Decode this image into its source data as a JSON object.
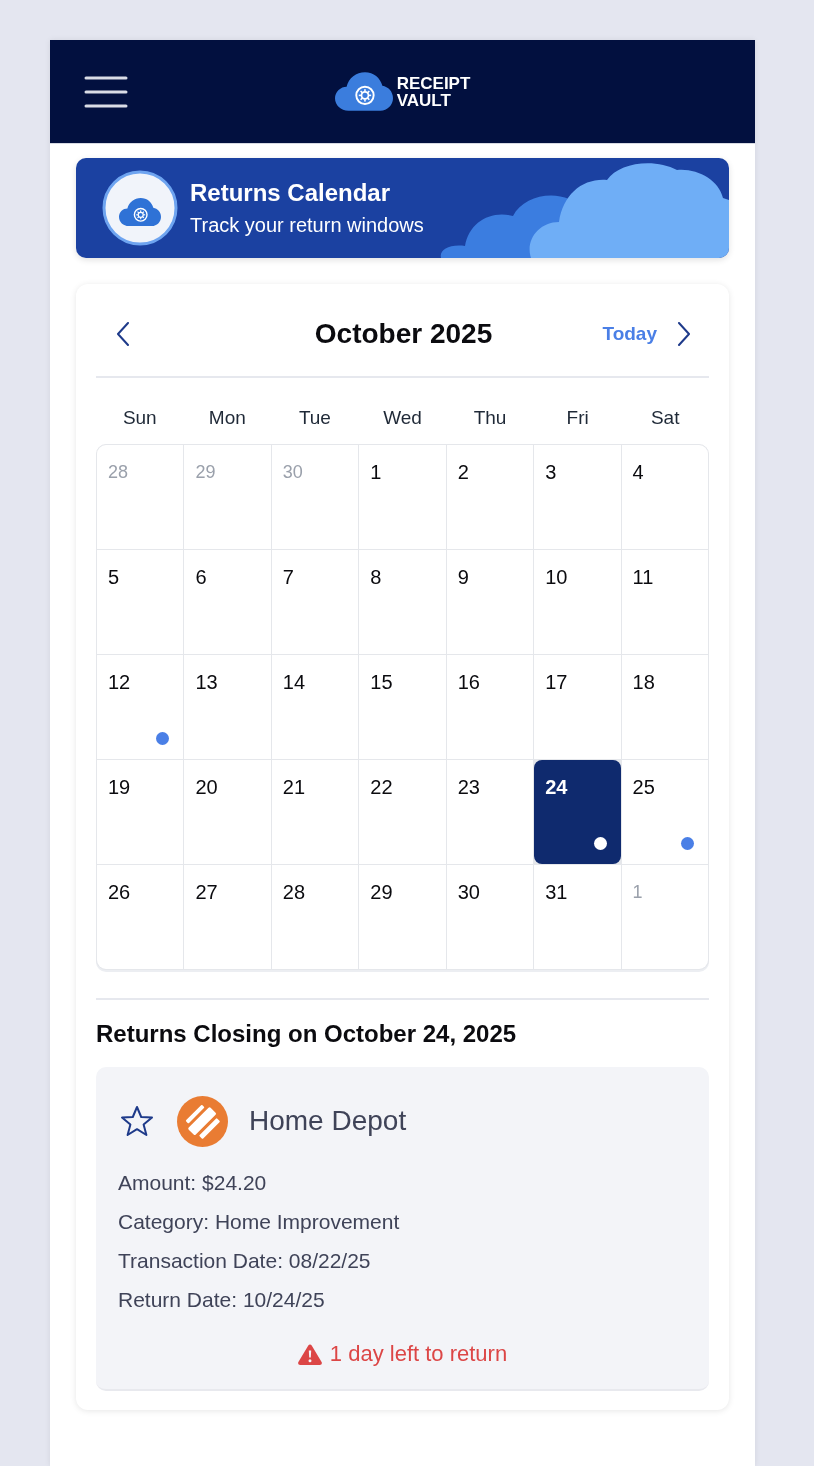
{
  "header": {
    "logo_text": "RECEIPT VAULT"
  },
  "banner": {
    "title": "Returns Calendar",
    "subtitle": "Track your return windows"
  },
  "calendar": {
    "month_title": "October 2025",
    "today_button": "Today",
    "weekdays": [
      "Sun",
      "Mon",
      "Tue",
      "Wed",
      "Thu",
      "Fri",
      "Sat"
    ],
    "days": [
      {
        "day": "28",
        "in_month": false,
        "selected": false,
        "has_return": false
      },
      {
        "day": "29",
        "in_month": false,
        "selected": false,
        "has_return": false
      },
      {
        "day": "30",
        "in_month": false,
        "selected": false,
        "has_return": false
      },
      {
        "day": "1",
        "in_month": true,
        "selected": false,
        "has_return": false
      },
      {
        "day": "2",
        "in_month": true,
        "selected": false,
        "has_return": false
      },
      {
        "day": "3",
        "in_month": true,
        "selected": false,
        "has_return": false
      },
      {
        "day": "4",
        "in_month": true,
        "selected": false,
        "has_return": false
      },
      {
        "day": "5",
        "in_month": true,
        "selected": false,
        "has_return": false
      },
      {
        "day": "6",
        "in_month": true,
        "selected": false,
        "has_return": false
      },
      {
        "day": "7",
        "in_month": true,
        "selected": false,
        "has_return": false
      },
      {
        "day": "8",
        "in_month": true,
        "selected": false,
        "has_return": false
      },
      {
        "day": "9",
        "in_month": true,
        "selected": false,
        "has_return": false
      },
      {
        "day": "10",
        "in_month": true,
        "selected": false,
        "has_return": false
      },
      {
        "day": "11",
        "in_month": true,
        "selected": false,
        "has_return": false
      },
      {
        "day": "12",
        "in_month": true,
        "selected": false,
        "has_return": true
      },
      {
        "day": "13",
        "in_month": true,
        "selected": false,
        "has_return": false
      },
      {
        "day": "14",
        "in_month": true,
        "selected": false,
        "has_return": false
      },
      {
        "day": "15",
        "in_month": true,
        "selected": false,
        "has_return": false
      },
      {
        "day": "16",
        "in_month": true,
        "selected": false,
        "has_return": false
      },
      {
        "day": "17",
        "in_month": true,
        "selected": false,
        "has_return": false
      },
      {
        "day": "18",
        "in_month": true,
        "selected": false,
        "has_return": false
      },
      {
        "day": "19",
        "in_month": true,
        "selected": false,
        "has_return": false
      },
      {
        "day": "20",
        "in_month": true,
        "selected": false,
        "has_return": false
      },
      {
        "day": "21",
        "in_month": true,
        "selected": false,
        "has_return": false
      },
      {
        "day": "22",
        "in_month": true,
        "selected": false,
        "has_return": false
      },
      {
        "day": "23",
        "in_month": true,
        "selected": false,
        "has_return": false
      },
      {
        "day": "24",
        "in_month": true,
        "selected": true,
        "has_return": true
      },
      {
        "day": "25",
        "in_month": true,
        "selected": false,
        "has_return": true
      },
      {
        "day": "26",
        "in_month": true,
        "selected": false,
        "has_return": false
      },
      {
        "day": "27",
        "in_month": true,
        "selected": false,
        "has_return": false
      },
      {
        "day": "28",
        "in_month": true,
        "selected": false,
        "has_return": false
      },
      {
        "day": "29",
        "in_month": true,
        "selected": false,
        "has_return": false
      },
      {
        "day": "30",
        "in_month": true,
        "selected": false,
        "has_return": false
      },
      {
        "day": "31",
        "in_month": true,
        "selected": false,
        "has_return": false
      },
      {
        "day": "1",
        "in_month": false,
        "selected": false,
        "has_return": false
      }
    ]
  },
  "closing": {
    "heading": "Returns Closing on October 24, 2025",
    "receipts": [
      {
        "starred": false,
        "store": "Home Depot",
        "details": [
          "Amount: $24.20",
          "Category: Home Improvement",
          "Transaction Date: 08/22/25",
          "Return Date: 10/24/25"
        ],
        "warning": "1 day left to return"
      }
    ]
  }
}
